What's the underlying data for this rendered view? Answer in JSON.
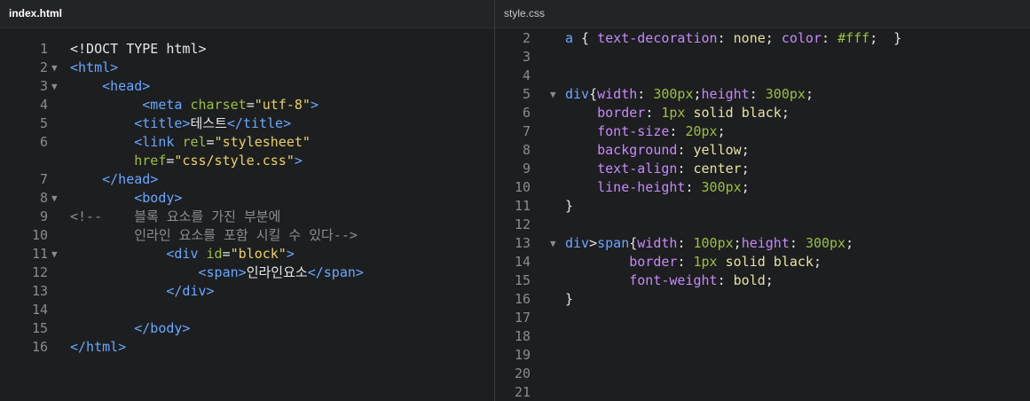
{
  "left_tab": "index.html",
  "right_tab": "style.css",
  "left_lines": [
    {
      "n": "1",
      "fold": false,
      "indent": "",
      "tokens": [
        [
          "t-txt",
          "<!DOCT TYPE html>"
        ]
      ]
    },
    {
      "n": "2",
      "fold": true,
      "indent": "",
      "tokens": [
        [
          "t-tag",
          "<html>"
        ]
      ]
    },
    {
      "n": "3",
      "fold": true,
      "indent": "    ",
      "tokens": [
        [
          "t-tag",
          "<head>"
        ]
      ]
    },
    {
      "n": "4",
      "fold": false,
      "indent": "         ",
      "tokens": [
        [
          "t-tag",
          "<meta "
        ],
        [
          "t-attr",
          "charset"
        ],
        [
          "t-pun",
          "="
        ],
        [
          "t-str",
          "\"utf-8\""
        ],
        [
          "t-tag",
          ">"
        ]
      ]
    },
    {
      "n": "5",
      "fold": false,
      "indent": "        ",
      "tokens": [
        [
          "t-tag",
          "<title>"
        ],
        [
          "t-txt",
          "테스트"
        ],
        [
          "t-tag",
          "</title>"
        ]
      ]
    },
    {
      "n": "6",
      "fold": false,
      "indent": "        ",
      "tokens": [
        [
          "t-tag",
          "<link "
        ],
        [
          "t-attr",
          "rel"
        ],
        [
          "t-pun",
          "="
        ],
        [
          "t-str",
          "\"stylesheet\""
        ]
      ]
    },
    {
      "n": "",
      "fold": false,
      "indent": "        ",
      "tokens": [
        [
          "t-attr",
          "href"
        ],
        [
          "t-pun",
          "="
        ],
        [
          "t-str",
          "\"css/style.css\""
        ],
        [
          "t-tag",
          ">"
        ]
      ]
    },
    {
      "n": "7",
      "fold": false,
      "indent": "    ",
      "tokens": [
        [
          "t-tag",
          "</head>"
        ]
      ]
    },
    {
      "n": "8",
      "fold": true,
      "indent": "        ",
      "tokens": [
        [
          "t-tag",
          "<body>"
        ]
      ]
    },
    {
      "n": "9",
      "fold": false,
      "indent": "",
      "tokens": [
        [
          "t-com",
          "<!--    블록 요소를 가진 부분에"
        ]
      ]
    },
    {
      "n": "10",
      "fold": false,
      "indent": "        ",
      "tokens": [
        [
          "t-com",
          "인라인 요소를 포함 시킬 수 있다-->"
        ]
      ]
    },
    {
      "n": "11",
      "fold": true,
      "indent": "            ",
      "tokens": [
        [
          "t-tag",
          "<div "
        ],
        [
          "t-attr",
          "id"
        ],
        [
          "t-pun",
          "="
        ],
        [
          "t-str",
          "\"block\""
        ],
        [
          "t-tag",
          ">"
        ]
      ]
    },
    {
      "n": "12",
      "fold": false,
      "indent": "                ",
      "tokens": [
        [
          "t-tag",
          "<span>"
        ],
        [
          "t-txt",
          "인라인요소"
        ],
        [
          "t-tag",
          "</span>"
        ]
      ]
    },
    {
      "n": "13",
      "fold": false,
      "indent": "            ",
      "tokens": [
        [
          "t-tag",
          "</div>"
        ]
      ]
    },
    {
      "n": "14",
      "fold": false,
      "indent": "",
      "tokens": []
    },
    {
      "n": "15",
      "fold": false,
      "indent": "        ",
      "tokens": [
        [
          "t-tag",
          "</body>"
        ]
      ]
    },
    {
      "n": "16",
      "fold": false,
      "indent": "",
      "tokens": [
        [
          "t-tag",
          "</html>"
        ]
      ]
    }
  ],
  "right_lines": [
    {
      "n": "2",
      "fold": false,
      "indent": "",
      "tokens": [
        [
          "t-sel",
          "a"
        ],
        [
          "t-pun",
          " { "
        ],
        [
          "t-prop",
          "text-decoration"
        ],
        [
          "t-pun",
          ": "
        ],
        [
          "t-val",
          "none"
        ],
        [
          "t-pun",
          "; "
        ],
        [
          "t-prop",
          "color"
        ],
        [
          "t-pun",
          ": "
        ],
        [
          "t-num",
          "#fff"
        ],
        [
          "t-pun",
          ";  }"
        ]
      ]
    },
    {
      "n": "3",
      "fold": false,
      "indent": "",
      "tokens": []
    },
    {
      "n": "4",
      "fold": false,
      "indent": "",
      "tokens": []
    },
    {
      "n": "5",
      "fold": true,
      "indent": "",
      "tokens": [
        [
          "t-sel",
          "div"
        ],
        [
          "t-pun",
          "{"
        ],
        [
          "t-prop",
          "width"
        ],
        [
          "t-pun",
          ": "
        ],
        [
          "t-num",
          "300px"
        ],
        [
          "t-pun",
          ";"
        ],
        [
          "t-prop",
          "height"
        ],
        [
          "t-pun",
          ": "
        ],
        [
          "t-num",
          "300px"
        ],
        [
          "t-pun",
          ";"
        ]
      ]
    },
    {
      "n": "6",
      "fold": false,
      "indent": "    ",
      "tokens": [
        [
          "t-prop",
          "border"
        ],
        [
          "t-pun",
          ": "
        ],
        [
          "t-num",
          "1px"
        ],
        [
          "t-pun",
          " "
        ],
        [
          "t-val",
          "solid"
        ],
        [
          "t-pun",
          " "
        ],
        [
          "t-val",
          "black"
        ],
        [
          "t-pun",
          ";"
        ]
      ]
    },
    {
      "n": "7",
      "fold": false,
      "indent": "    ",
      "tokens": [
        [
          "t-prop",
          "font-size"
        ],
        [
          "t-pun",
          ": "
        ],
        [
          "t-num",
          "20px"
        ],
        [
          "t-pun",
          ";"
        ]
      ]
    },
    {
      "n": "8",
      "fold": false,
      "indent": "    ",
      "tokens": [
        [
          "t-prop",
          "background"
        ],
        [
          "t-pun",
          ": "
        ],
        [
          "t-val",
          "yellow"
        ],
        [
          "t-pun",
          ";"
        ]
      ]
    },
    {
      "n": "9",
      "fold": false,
      "indent": "    ",
      "tokens": [
        [
          "t-prop",
          "text-align"
        ],
        [
          "t-pun",
          ": "
        ],
        [
          "t-val",
          "center"
        ],
        [
          "t-pun",
          ";"
        ]
      ]
    },
    {
      "n": "10",
      "fold": false,
      "indent": "    ",
      "tokens": [
        [
          "t-prop",
          "line-height"
        ],
        [
          "t-pun",
          ": "
        ],
        [
          "t-num",
          "300px"
        ],
        [
          "t-pun",
          ";"
        ]
      ]
    },
    {
      "n": "11",
      "fold": false,
      "indent": "",
      "tokens": [
        [
          "t-pun",
          "}"
        ]
      ]
    },
    {
      "n": "12",
      "fold": false,
      "indent": "",
      "tokens": []
    },
    {
      "n": "13",
      "fold": true,
      "indent": "",
      "tokens": [
        [
          "t-sel",
          "div"
        ],
        [
          "t-pun",
          ">"
        ],
        [
          "t-sel",
          "span"
        ],
        [
          "t-pun",
          "{"
        ],
        [
          "t-prop",
          "width"
        ],
        [
          "t-pun",
          ": "
        ],
        [
          "t-num",
          "100px"
        ],
        [
          "t-pun",
          ";"
        ],
        [
          "t-prop",
          "height"
        ],
        [
          "t-pun",
          ": "
        ],
        [
          "t-num",
          "300px"
        ],
        [
          "t-pun",
          ";"
        ]
      ]
    },
    {
      "n": "14",
      "fold": false,
      "indent": "        ",
      "tokens": [
        [
          "t-prop",
          "border"
        ],
        [
          "t-pun",
          ": "
        ],
        [
          "t-num",
          "1px"
        ],
        [
          "t-pun",
          " "
        ],
        [
          "t-val",
          "solid"
        ],
        [
          "t-pun",
          " "
        ],
        [
          "t-val",
          "black"
        ],
        [
          "t-pun",
          ";"
        ]
      ]
    },
    {
      "n": "15",
      "fold": false,
      "indent": "        ",
      "tokens": [
        [
          "t-prop",
          "font-weight"
        ],
        [
          "t-pun",
          ": "
        ],
        [
          "t-val",
          "bold"
        ],
        [
          "t-pun",
          ";"
        ]
      ]
    },
    {
      "n": "16",
      "fold": false,
      "indent": "",
      "tokens": [
        [
          "t-pun",
          "}"
        ]
      ]
    },
    {
      "n": "17",
      "fold": false,
      "indent": "",
      "tokens": []
    },
    {
      "n": "18",
      "fold": false,
      "indent": "",
      "tokens": []
    },
    {
      "n": "19",
      "fold": false,
      "indent": "",
      "tokens": []
    },
    {
      "n": "20",
      "fold": false,
      "indent": "",
      "tokens": []
    },
    {
      "n": "21",
      "fold": false,
      "indent": "",
      "tokens": []
    }
  ]
}
